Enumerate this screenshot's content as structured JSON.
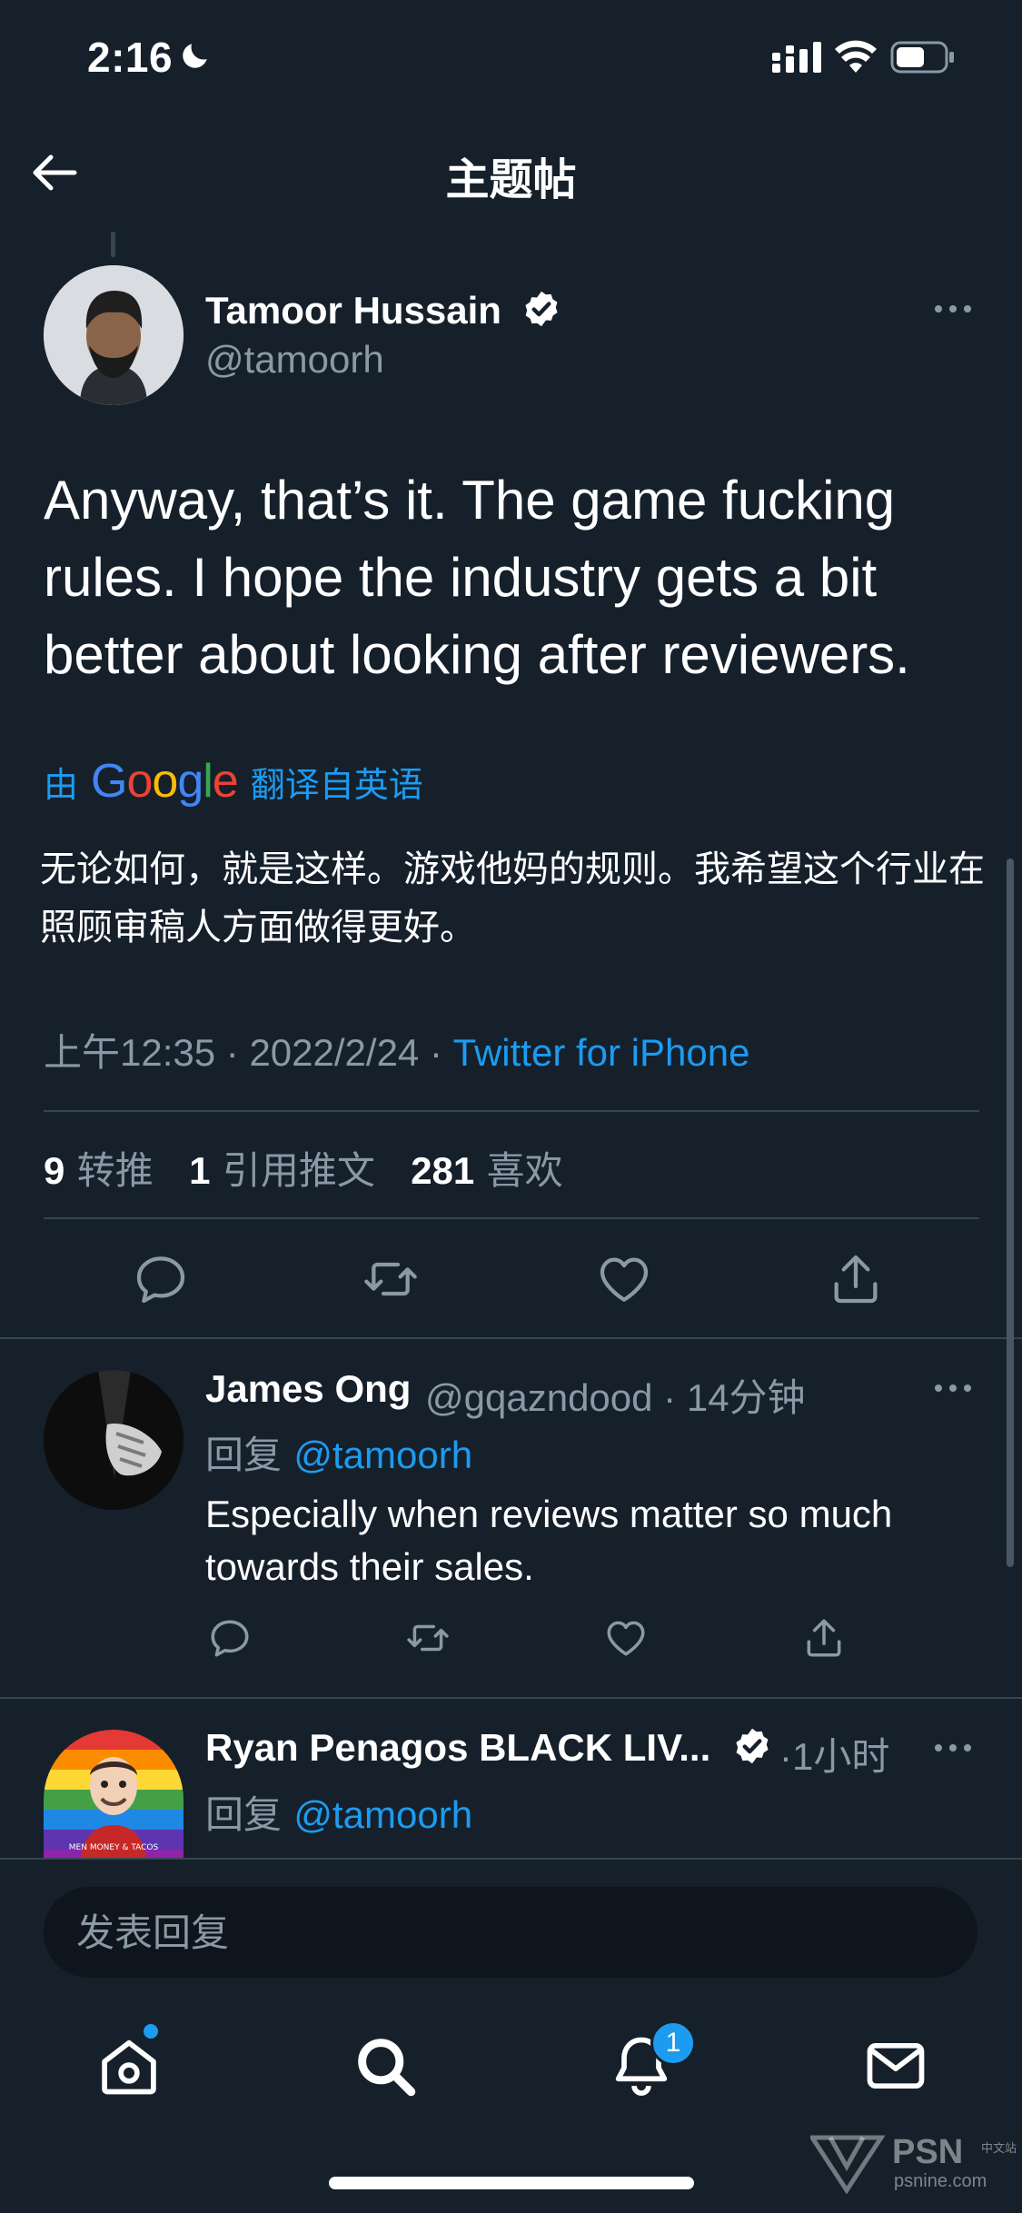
{
  "status_bar": {
    "time": "2:16"
  },
  "header": {
    "title": "主题帖"
  },
  "tweet": {
    "author_name": "Tamoor Hussain",
    "author_handle": "@tamoorh",
    "text": "Anyway, that’s it. The game fucking rules. I hope the industry gets a bit better about looking after reviewers.",
    "translate_prefix": "由",
    "translate_brand": "Google",
    "translate_suffix": "翻译自英语",
    "translated_text": "无论如何，就是这样。游戏他妈的规则。我希望这个行业在照顾审稿人方面做得更好。",
    "time": "上午12:35",
    "date": "2022/2/24",
    "source": "Twitter for iPhone",
    "retweets_count": "9",
    "retweets_label": "转推",
    "quotes_count": "1",
    "quotes_label": "引用推文",
    "likes_count": "281",
    "likes_label": "喜欢"
  },
  "replies": [
    {
      "name": "James Ong",
      "handle": "@gqazndood",
      "time": "14分钟",
      "reply_prefix": "回复",
      "reply_to": "@tamoorh",
      "text": "Especially when reviews matter so much towards their sales."
    },
    {
      "name": "Ryan Penagos BLACK LIV...",
      "time": "1小时",
      "reply_prefix": "回复",
      "reply_to": "@tamoorh",
      "avatar_text": "MEN MONEY & TACOS"
    }
  ],
  "compose": {
    "placeholder": "发表回复"
  },
  "tabbar": {
    "notification_count": "1"
  },
  "watermark": {
    "title": "PSN",
    "small": "中文站",
    "sub": "psnine.com"
  },
  "colors": {
    "background": "#15202b",
    "accent": "#1d9bf0",
    "secondary_text": "#8b98a5",
    "divider": "#38444d"
  }
}
